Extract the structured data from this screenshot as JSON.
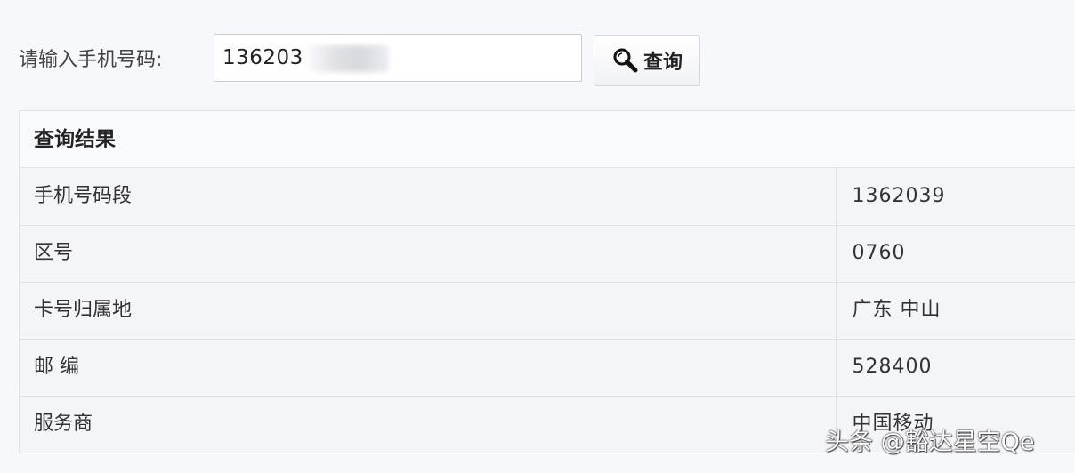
{
  "search": {
    "label": "请输入手机号码:",
    "value": "136203",
    "button_label": "查询",
    "button_icon": "search-icon"
  },
  "result": {
    "title": "查询结果",
    "rows": [
      {
        "key": "手机号码段",
        "value": "1362039"
      },
      {
        "key": "区号",
        "value": "0760"
      },
      {
        "key": "卡号归属地",
        "value": "广东 中山"
      },
      {
        "key": "邮 编",
        "value": "528400"
      },
      {
        "key": "服务商",
        "value": "中国移动"
      }
    ]
  },
  "watermark": "头条 @豁达星空Qe"
}
